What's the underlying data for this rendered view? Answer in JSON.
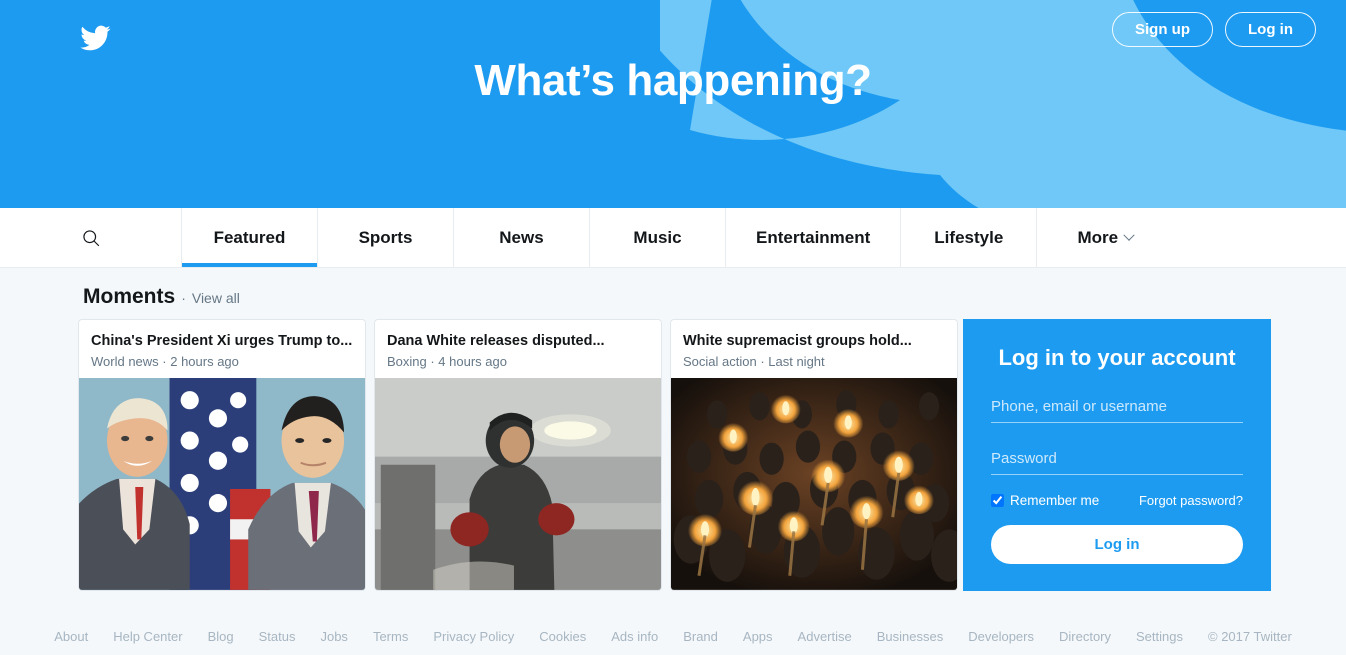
{
  "hero": {
    "title": "What’s happening?",
    "logo_icon": "twitter-bird-icon",
    "watermark_icon": "twitter-bird-watermark-icon",
    "bg_color": "#1d9bf0",
    "watermark_color": "#6fc8f7",
    "signup_label": "Sign up",
    "login_label": "Log in"
  },
  "nav": {
    "search_icon": "search-icon",
    "chevron_icon": "chevron-down-icon",
    "tabs": [
      {
        "label": "Featured",
        "active": true
      },
      {
        "label": "Sports",
        "active": false
      },
      {
        "label": "News",
        "active": false
      },
      {
        "label": "Music",
        "active": false
      },
      {
        "label": "Entertainment",
        "active": false
      },
      {
        "label": "Lifestyle",
        "active": false
      },
      {
        "label": "More",
        "active": false
      }
    ],
    "active_underline_color": "#1d9bf0"
  },
  "main": {
    "section_title": "Moments",
    "separator": "·",
    "view_all_label": "View all",
    "cards": [
      {
        "title": "China's President Xi urges Trump to...",
        "meta": "World news · 2 hours ago",
        "category": "World news",
        "time": "2 hours ago",
        "image_alt": "trump-and-xi-handshake-photo"
      },
      {
        "title": "Dana White releases disputed...",
        "meta": "Boxing · 4 hours ago",
        "category": "Boxing",
        "time": "4 hours ago",
        "image_alt": "boxing-training-photo"
      },
      {
        "title": "White supremacist groups hold...",
        "meta": "Social action · Last night",
        "category": "Social action",
        "time": "Last night",
        "image_alt": "torch-rally-crowd-night-photo"
      }
    ]
  },
  "login_panel": {
    "title": "Log in to your account",
    "username_placeholder": "Phone, email or username",
    "username_value": "",
    "password_placeholder": "Password",
    "password_value": "",
    "remember_label": "Remember me",
    "remember_checked": true,
    "forgot_label": "Forgot password?",
    "submit_label": "Log in",
    "bg_color": "#1d9bf0"
  },
  "footer": {
    "links": [
      "About",
      "Help Center",
      "Blog",
      "Status",
      "Jobs",
      "Terms",
      "Privacy Policy",
      "Cookies",
      "Ads info",
      "Brand",
      "Apps",
      "Advertise",
      "Businesses",
      "Developers",
      "Directory",
      "Settings"
    ],
    "copyright": "© 2017 Twitter"
  }
}
